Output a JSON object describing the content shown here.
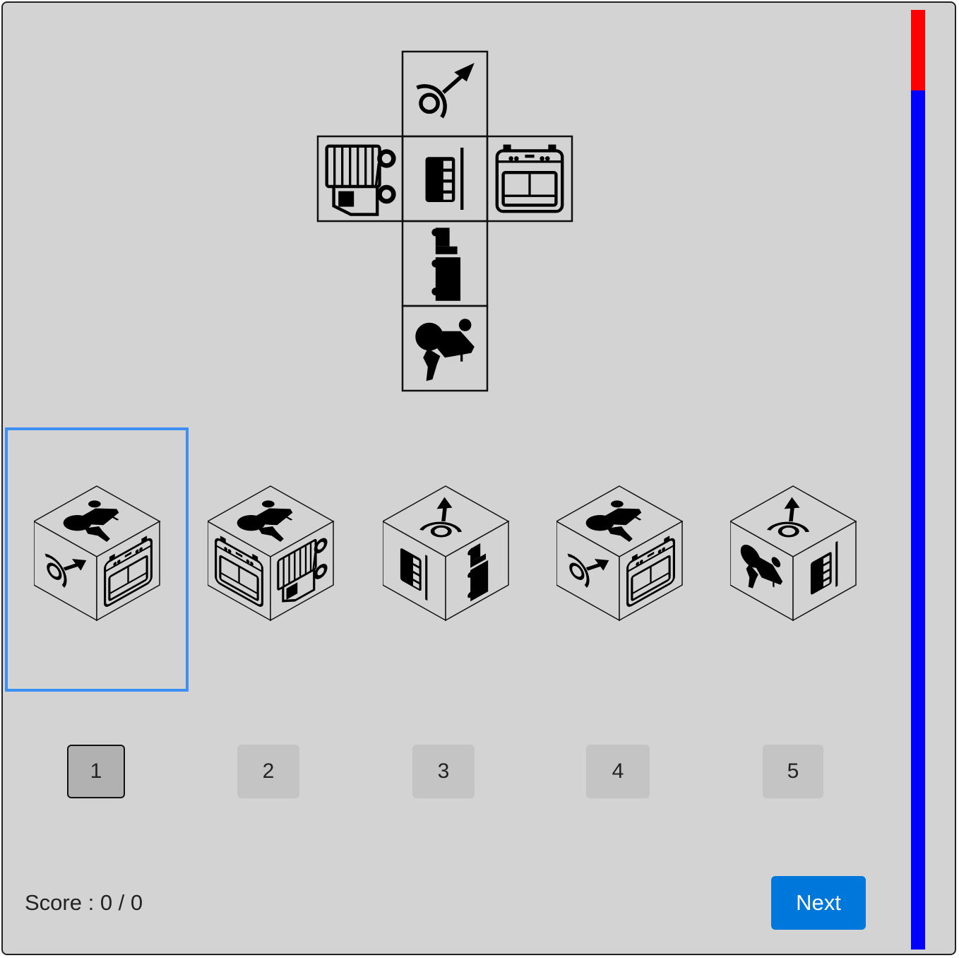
{
  "net": {
    "faces": [
      {
        "position": "top",
        "icon": "mars-ring-icon"
      },
      {
        "position": "left",
        "icon": "truck-grille-icon"
      },
      {
        "position": "center",
        "icon": "panel-icon"
      },
      {
        "position": "right",
        "icon": "stove-icon"
      },
      {
        "position": "below",
        "icon": "truck-side-icon"
      },
      {
        "position": "bottom",
        "icon": "turkey-icon"
      }
    ]
  },
  "cubes": [
    {
      "top": "turkey-icon",
      "left": "mars-ring-icon",
      "right": "stove-icon"
    },
    {
      "top": "turkey-icon",
      "left": "stove-icon",
      "right": "truck-grille-icon"
    },
    {
      "top": "mars-ring-icon",
      "left": "panel-icon",
      "right": "truck-side-icon"
    },
    {
      "top": "turkey-icon",
      "left": "mars-ring-icon",
      "right": "stove-icon"
    },
    {
      "top": "mars-ring-icon",
      "left": "turkey-icon",
      "right": "panel-icon"
    }
  ],
  "options": [
    "1",
    "2",
    "3",
    "4",
    "5"
  ],
  "selected_option": "1",
  "score_label": "Score : 0 / 0",
  "next_label": "Next",
  "timer": {
    "elapsed_fraction": 0.086,
    "elapsed_color": "#ff0000",
    "remaining_color": "#0000ff"
  },
  "colors": {
    "selection": "#3d8ef5",
    "next_button": "#0077db",
    "background": "#d3d3d3"
  }
}
